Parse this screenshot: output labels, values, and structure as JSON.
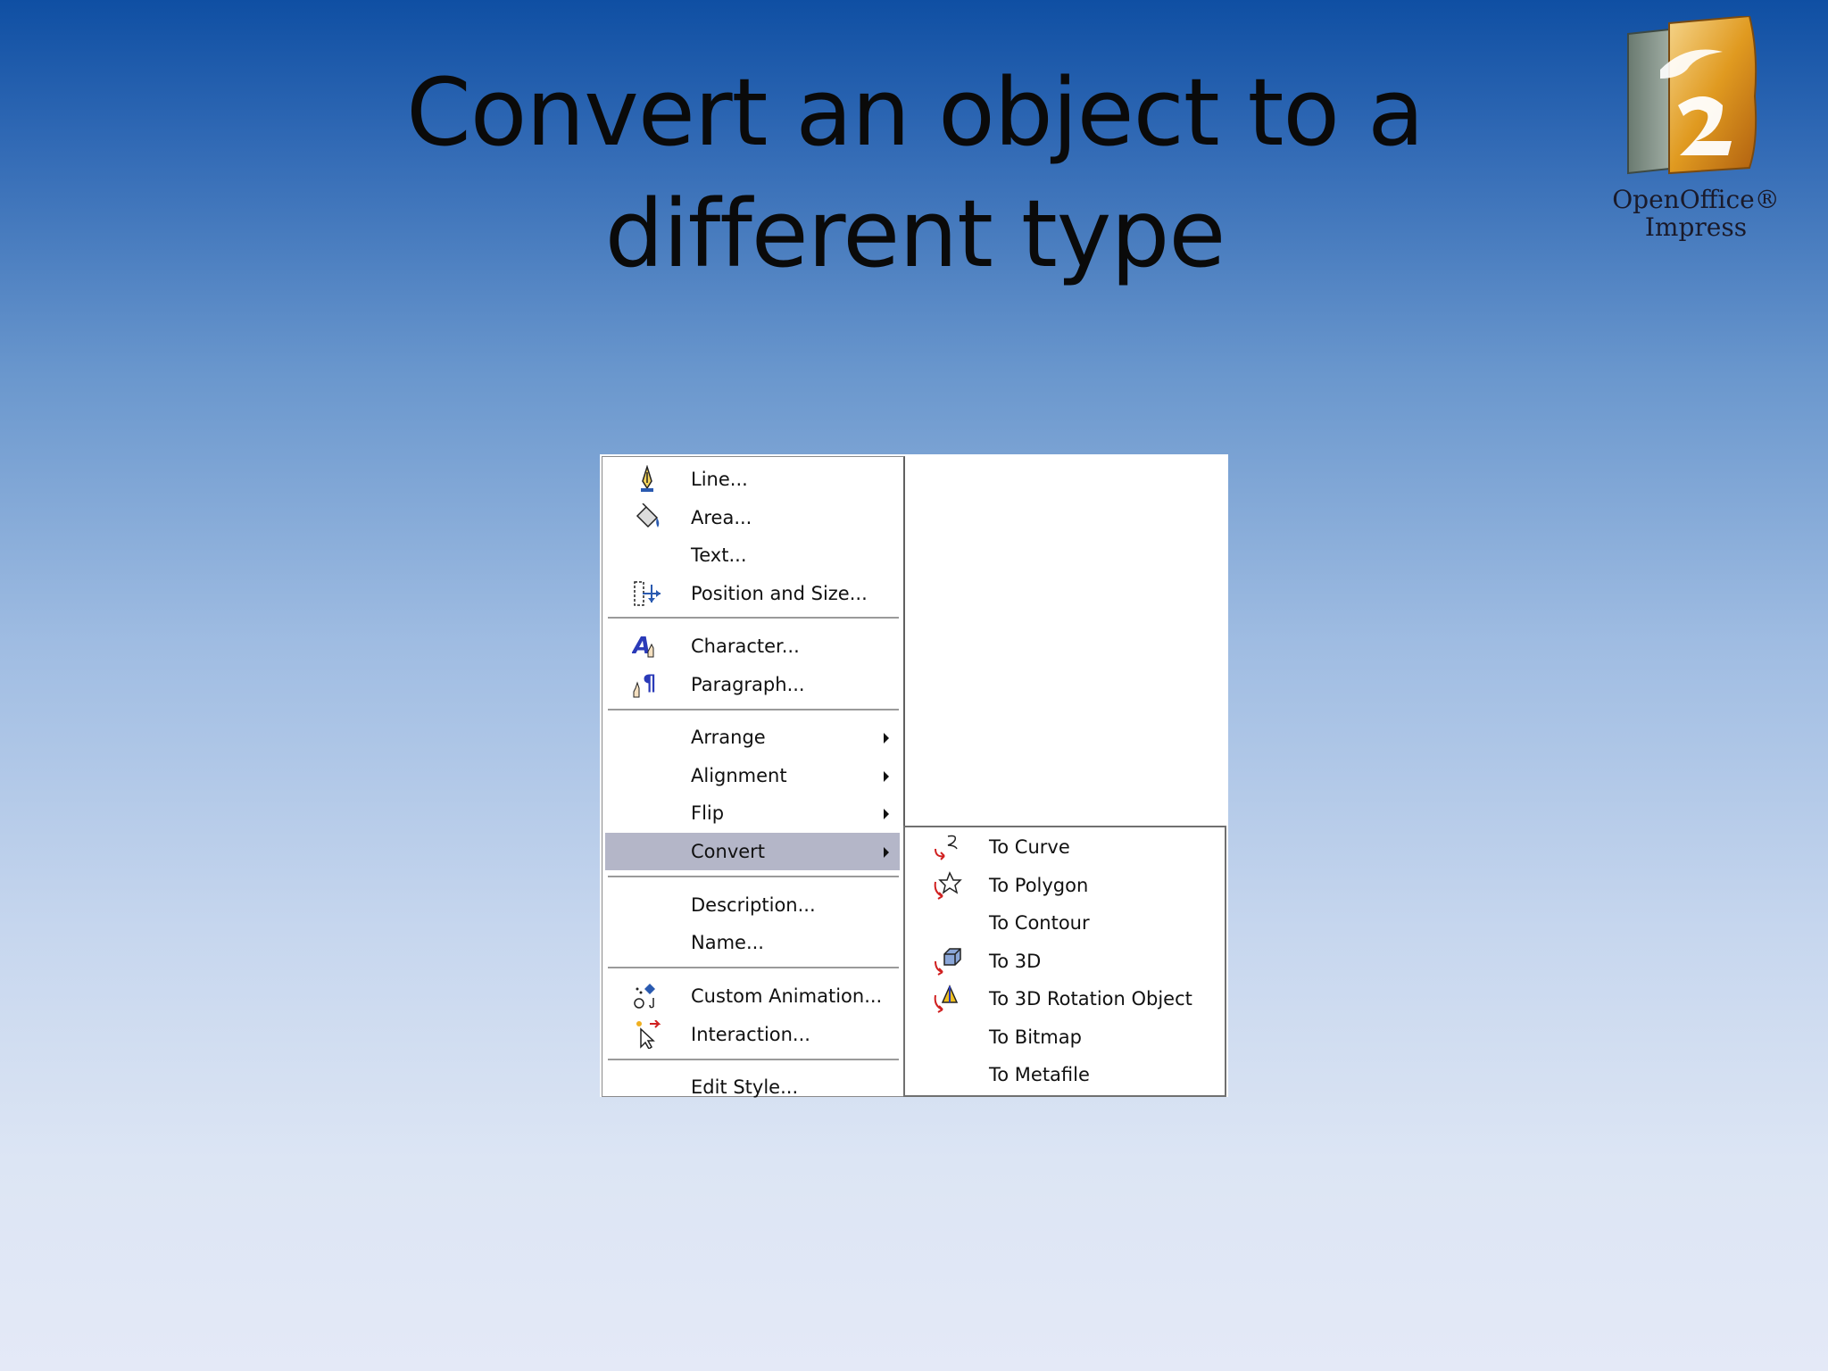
{
  "slide": {
    "title_line1": "Convert an object to a",
    "title_line2": "different type"
  },
  "logo": {
    "line1": "OpenOffice®",
    "line2": "Impress"
  },
  "context_menu": {
    "items": [
      {
        "label": "Line...",
        "icon": "line-pen-icon"
      },
      {
        "label": "Area...",
        "icon": "paint-bucket-icon"
      },
      {
        "label": "Text...",
        "icon": null
      },
      {
        "label": "Position and Size...",
        "icon": "position-size-icon"
      },
      {
        "label": "Character...",
        "icon": "character-icon"
      },
      {
        "label": "Paragraph...",
        "icon": "paragraph-icon"
      },
      {
        "label": "Arrange",
        "icon": null,
        "submenu": true
      },
      {
        "label": "Alignment",
        "icon": null,
        "submenu": true
      },
      {
        "label": "Flip",
        "icon": null,
        "submenu": true
      },
      {
        "label": "Convert",
        "icon": null,
        "submenu": true,
        "highlighted": true
      },
      {
        "label": "Description...",
        "icon": null
      },
      {
        "label": "Name...",
        "icon": null
      },
      {
        "label": "Custom Animation...",
        "icon": "custom-animation-icon"
      },
      {
        "label": "Interaction...",
        "icon": "interaction-icon"
      },
      {
        "label": "Edit Style...",
        "icon": null
      }
    ]
  },
  "convert_submenu": {
    "items": [
      {
        "label": "To Curve",
        "icon": "to-curve-icon"
      },
      {
        "label": "To Polygon",
        "icon": "to-polygon-icon"
      },
      {
        "label": "To Contour",
        "icon": null
      },
      {
        "label": "To 3D",
        "icon": "to-3d-icon"
      },
      {
        "label": "To 3D Rotation Object",
        "icon": "to-3d-rotation-icon"
      },
      {
        "label": "To Bitmap",
        "icon": null
      },
      {
        "label": "To Metafile",
        "icon": null
      }
    ]
  },
  "colors": {
    "highlight": "#b4b6c8",
    "background_top": "#0f4fa3",
    "background_bottom": "#e4e9f7"
  }
}
